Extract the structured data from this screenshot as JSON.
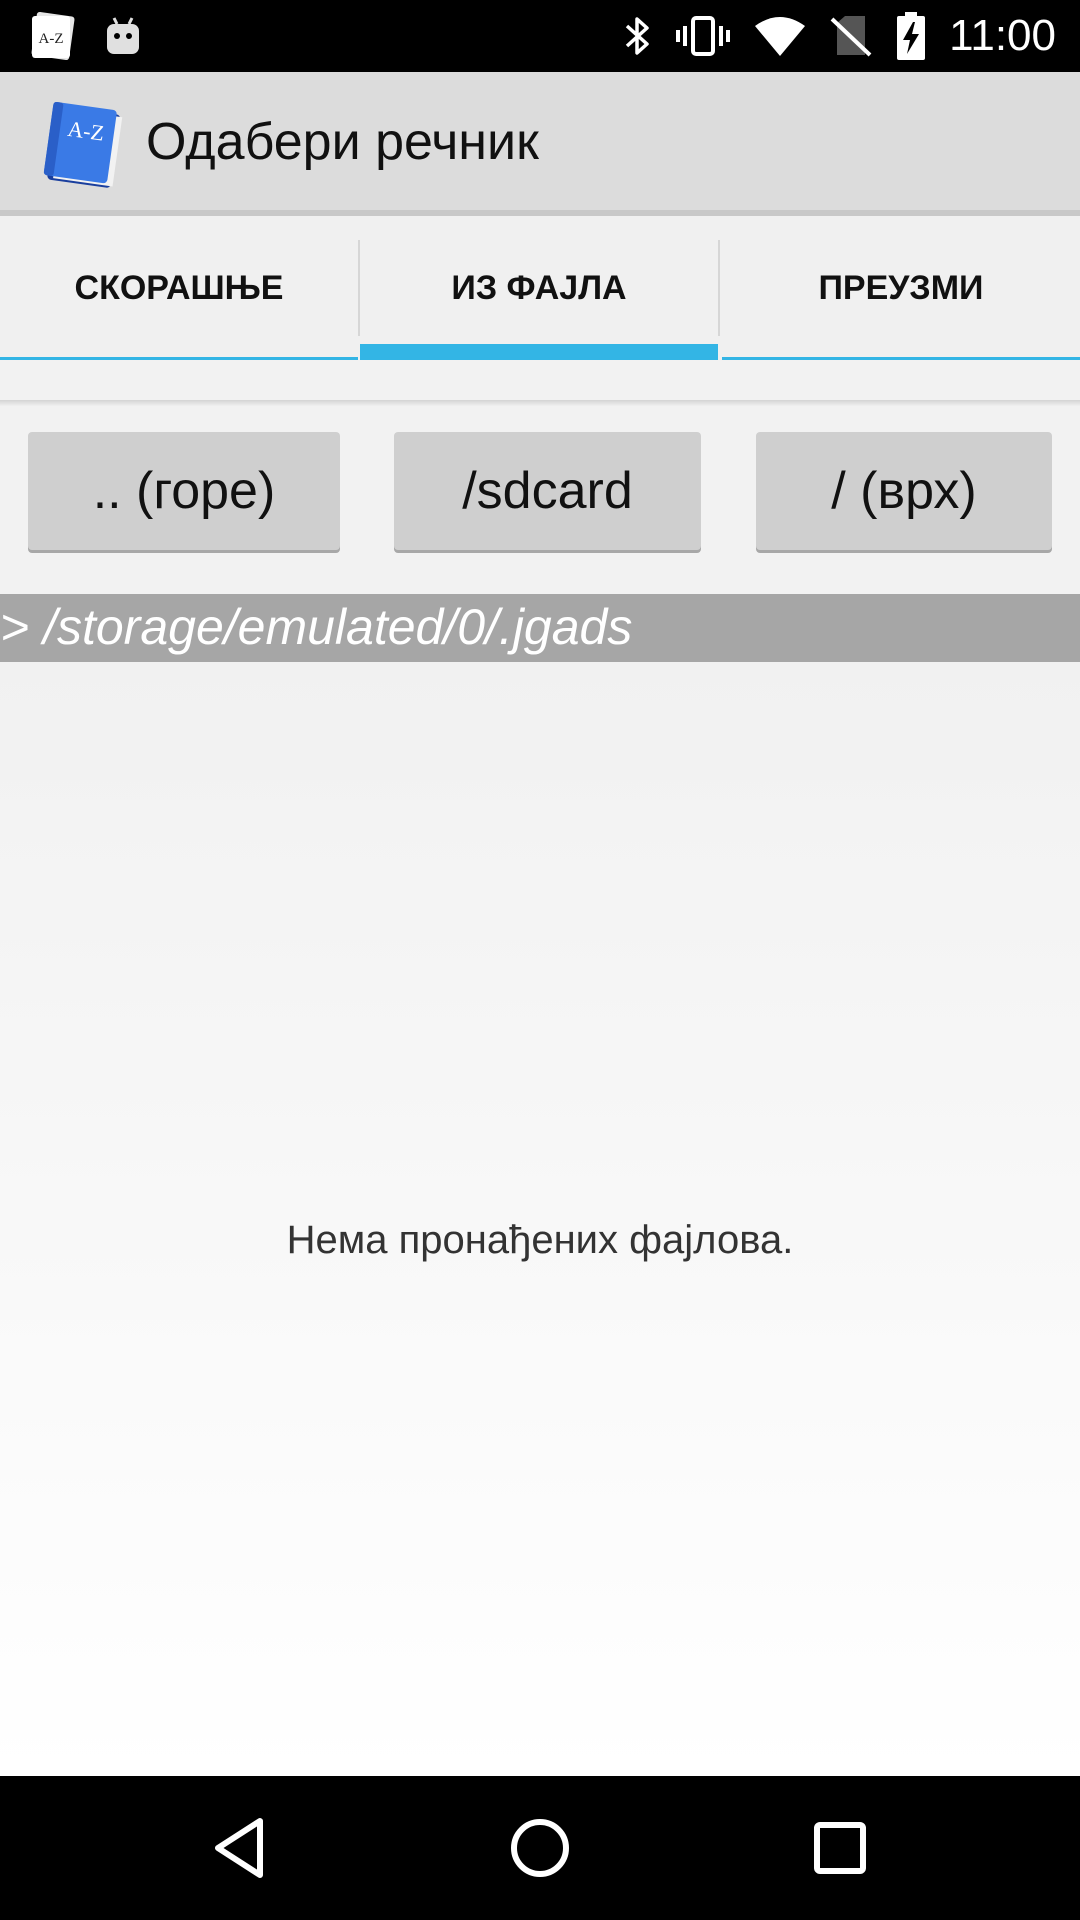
{
  "status_bar": {
    "time": "11:00",
    "left_icons": [
      "dictionary-notification-icon",
      "android-icon"
    ],
    "right_icons": [
      "bluetooth-icon",
      "vibrate-icon",
      "wifi-icon",
      "no-sim-icon",
      "battery-charging-icon"
    ]
  },
  "action_bar": {
    "title": "Одабери речник",
    "app_icon_text": "A-Z"
  },
  "tabs": [
    {
      "label": "СКОРАШЊЕ",
      "selected": false
    },
    {
      "label": "ИЗ ФАЈЛА",
      "selected": true
    },
    {
      "label": "ПРЕУЗМИ",
      "selected": false
    }
  ],
  "nav_buttons": {
    "up": ".. (горе)",
    "sdcard": "/sdcard",
    "root": "/ (врх)"
  },
  "path": "> /storage/emulated/0/.jgads",
  "empty_message": "Нема пронађених фајлова.",
  "colors": {
    "accent": "#33b5e5",
    "action_bar": "#dcdcdc",
    "path_bar": "#a6a6a6",
    "button": "#cfcfcf"
  },
  "system_nav": [
    "back-icon",
    "home-icon",
    "recents-icon"
  ]
}
